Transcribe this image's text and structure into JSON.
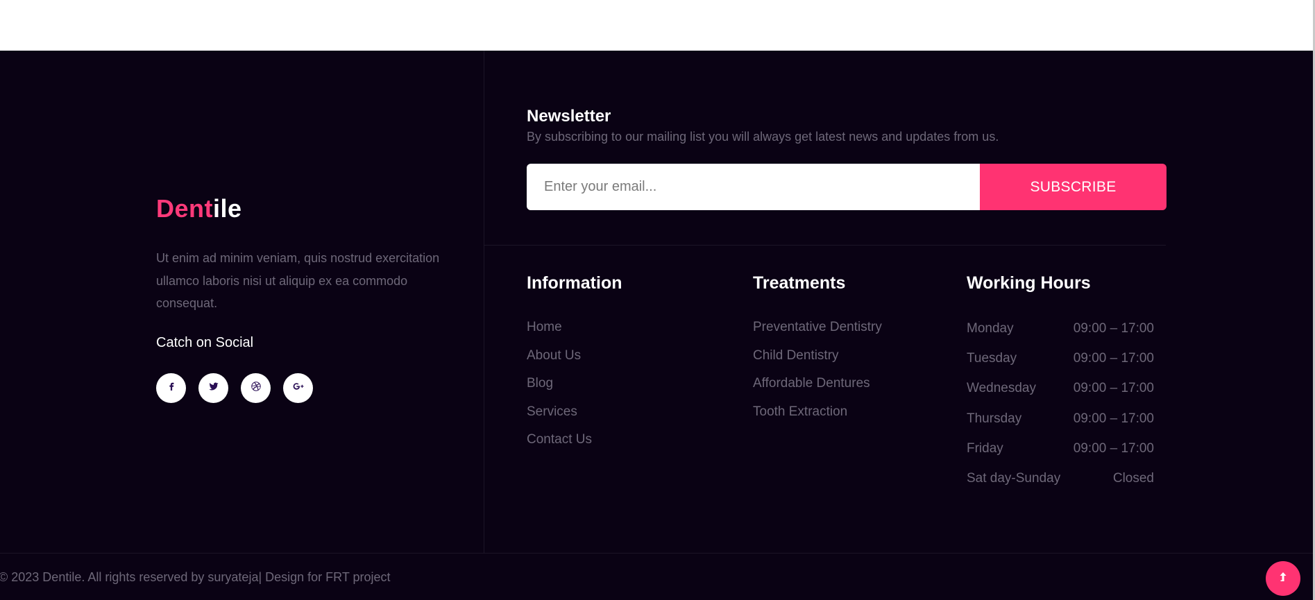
{
  "brand": {
    "part1": "Dent",
    "part2": "ile"
  },
  "about": {
    "text": "Ut enim ad minim veniam, quis nostrud exercitation ullamco laboris nisi ut aliquip ex ea commodo consequat."
  },
  "social": {
    "title": "Catch on Social",
    "icons": [
      "facebook-icon",
      "twitter-icon",
      "dribbble-icon",
      "google-plus-icon"
    ]
  },
  "newsletter": {
    "title": "Newsletter",
    "subtitle": "By subscribing to our mailing list you will always get latest news and updates from us.",
    "placeholder": "Enter your email...",
    "button": "SUBSCRIBE"
  },
  "information": {
    "title": "Information",
    "links": [
      "Home",
      "About Us",
      "Blog",
      "Services",
      "Contact Us"
    ]
  },
  "treatments": {
    "title": "Treatments",
    "links": [
      "Preventative Dentistry",
      "Child Dentistry",
      "Affordable Dentures",
      "Tooth Extraction"
    ]
  },
  "hours": {
    "title": "Working Hours",
    "rows": [
      {
        "day": "Monday",
        "time": "09:00 – 17:00"
      },
      {
        "day": "Tuesday",
        "time": "09:00 – 17:00"
      },
      {
        "day": "Wednesday",
        "time": "09:00 – 17:00"
      },
      {
        "day": "Thursday",
        "time": "09:00 – 17:00"
      },
      {
        "day": "Friday",
        "time": "09:00 – 17:00"
      },
      {
        "day": "Sat day-Sunday",
        "time": "Closed"
      }
    ]
  },
  "copyright": "© 2023 Dentile. All rights reserved by suryateja| Design for FRT project",
  "colors": {
    "accent": "#ff3372",
    "background": "#0a0214",
    "muted": "#6e6879"
  }
}
